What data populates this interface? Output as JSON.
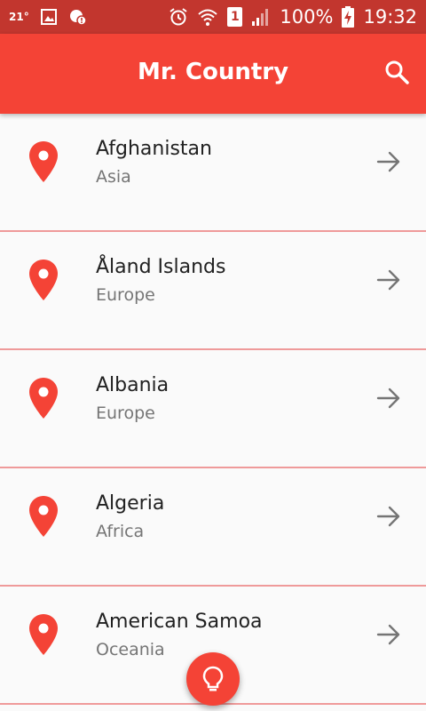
{
  "status_bar": {
    "temperature": "21°",
    "battery": "100%",
    "time": "19:32",
    "sim_slot": "1"
  },
  "app_bar": {
    "title": "Mr. Country"
  },
  "countries": [
    {
      "name": "Afghanistan",
      "region": "Asia"
    },
    {
      "name": "Åland Islands",
      "region": "Europe"
    },
    {
      "name": "Albania",
      "region": "Europe"
    },
    {
      "name": "Algeria",
      "region": "Africa"
    },
    {
      "name": "American Samoa",
      "region": "Oceania"
    }
  ],
  "colors": {
    "accent": "#f44336",
    "status_bar": "#c2362e",
    "divider": "#ef9a9a"
  },
  "icons": {
    "row_leading": "location-pin-icon",
    "row_trailing": "arrow-right-icon",
    "app_bar_action": "search-icon",
    "fab": "lightbulb-icon"
  }
}
